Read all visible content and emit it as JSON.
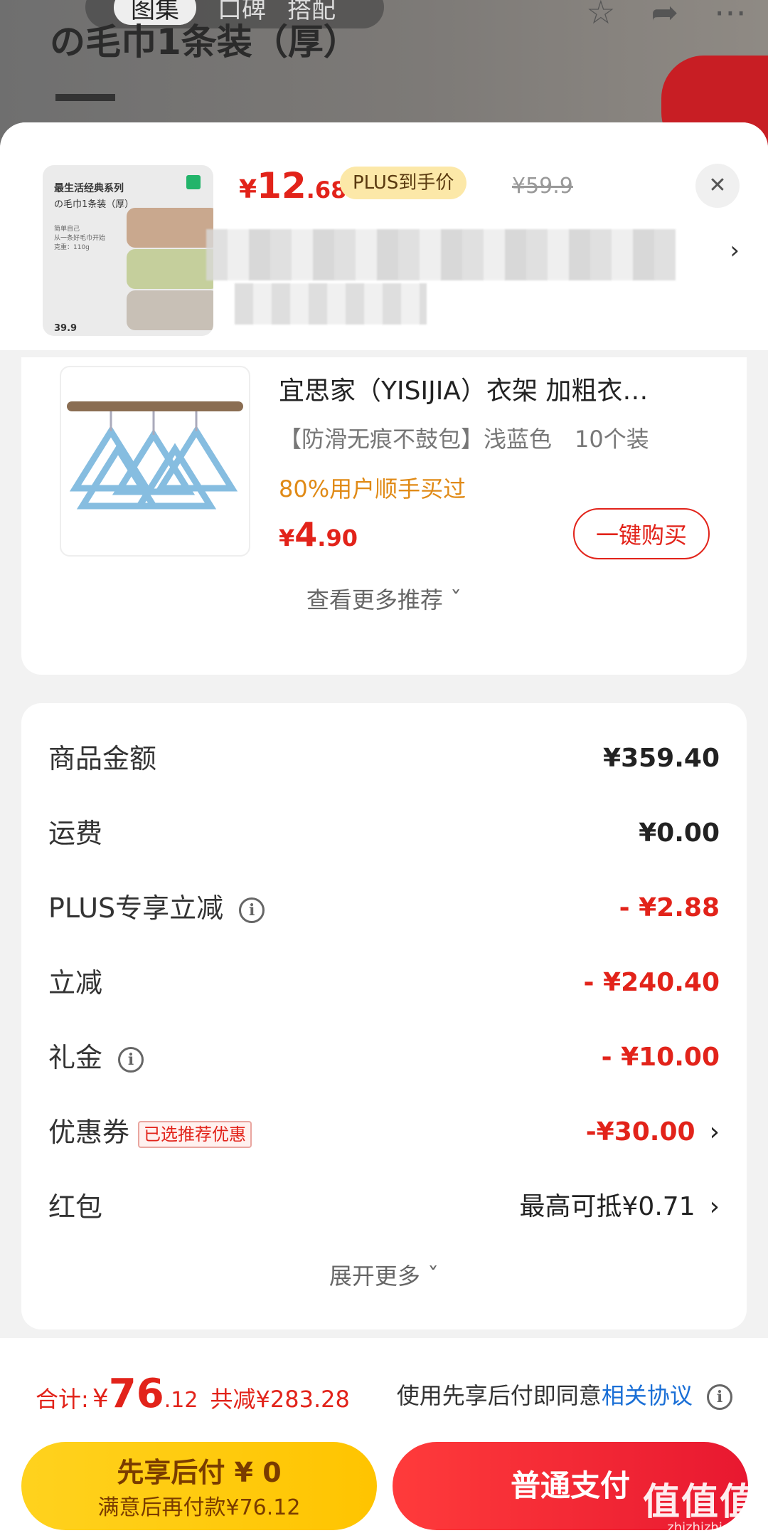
{
  "background": {
    "title_line": "の毛巾1条装（厚）",
    "tabs": [
      "图集",
      "口碑",
      "搭配"
    ]
  },
  "header": {
    "thumb_title": "最生活经典系列",
    "thumb_sub": "の毛巾1条装（厚）",
    "thumb_note": "简单自己\n从一条好毛巾开始\n克重：110g",
    "thumb_price": "39.9",
    "price_symbol": "¥",
    "price_int": "12",
    "price_dec": ".68",
    "plus_label": "PLUS到手价",
    "original_price": "¥59.9",
    "close_icon": "close-icon",
    "chevron": "›"
  },
  "recommend": {
    "title": "宜思家（YISIJIA）衣架 加粗衣…",
    "spec": "【防滑无痕不鼓包】浅蓝色　10个装",
    "bought": "80%用户顺手买过",
    "price_symbol": "¥",
    "price_int": "4",
    "price_dec": ".90",
    "buy_label": "一键购买",
    "more_label": "查看更多推荐 ˇ"
  },
  "summary": {
    "rows": [
      {
        "label": "商品金额",
        "value": "¥359.40"
      },
      {
        "label": "运费",
        "value": "¥0.00"
      },
      {
        "label": "PLUS专享立减",
        "value": "- ¥2.88"
      },
      {
        "label": "立减",
        "value": "- ¥240.40"
      },
      {
        "label": "礼金",
        "value": "- ¥10.00"
      },
      {
        "label": "优惠券",
        "tag": "已选推荐优惠",
        "value": "-¥30.00"
      },
      {
        "label": "红包",
        "value": "最高可抵¥0.71"
      }
    ],
    "expand_label": "展开更多 ˇ",
    "info_icon": "i",
    "arrow": "›"
  },
  "footer": {
    "total_label": "合计:",
    "total_symbol": "¥",
    "total_int": "76",
    "total_dec": ".12",
    "reduce_text": "共减¥283.28",
    "agree_text": "使用先享后付即同意",
    "agree_link": "相关协议",
    "later_title": "先享后付 ¥ 0",
    "later_sub": "满意后再付款¥76.12",
    "pay_label": "普通支付"
  },
  "watermark": {
    "text": "值值值",
    "sub": "zhizhizhi.com"
  },
  "colors": {
    "accent": "#e2231a",
    "plus_gold": "#fce8a8",
    "link": "#1a6fd6",
    "yellow_btn": "#ffd21e"
  }
}
